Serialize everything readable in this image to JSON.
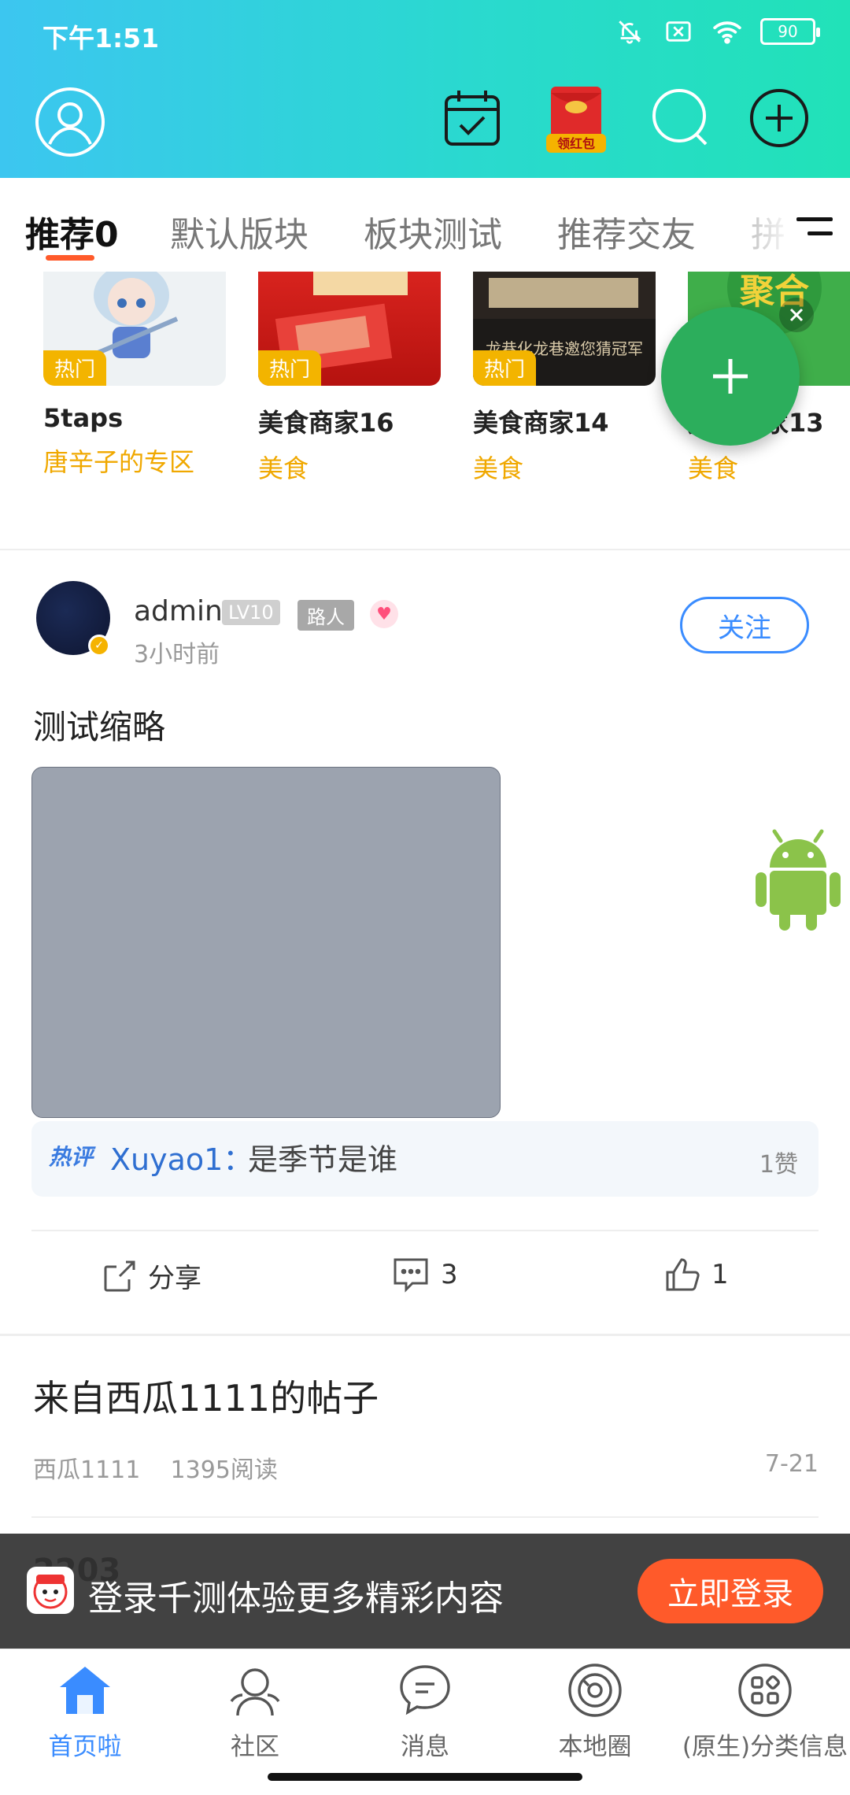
{
  "status_bar": {
    "time": "下午1:51",
    "battery": "90"
  },
  "header": {
    "icons": [
      "avatar-icon",
      "calendar-checkin-icon",
      "red-packet-icon",
      "search-icon",
      "plus-circle-icon"
    ],
    "red_packet_label": "领红包"
  },
  "tabs": [
    {
      "label": "推荐0",
      "active": true
    },
    {
      "label": "默认版块"
    },
    {
      "label": "板块测试"
    },
    {
      "label": "推荐交友"
    },
    {
      "label": "拼"
    }
  ],
  "boards": [
    {
      "name": "5taps",
      "category": "唐辛子的专区",
      "badge": "热门"
    },
    {
      "name": "美食商家16",
      "category": "美食",
      "badge": "热门"
    },
    {
      "name": "美食商家14",
      "category": "美食",
      "badge": "热门",
      "thumb_text": "龙巷化龙巷邀您猜冠军"
    },
    {
      "name": "美食商家13",
      "category": "美食",
      "thumb_text": "聚合"
    }
  ],
  "post1": {
    "username": "admin",
    "level": "LV10",
    "role": "路人",
    "time": "3小时前",
    "follow_label": "关注",
    "title": "测试缩略",
    "hot_comment": {
      "tag": "热评",
      "user": "Xuyao1",
      "text": "是季节是谁",
      "likes": "1赞"
    },
    "actions": {
      "share": "分享",
      "comments": "3",
      "likes": "1"
    }
  },
  "post2": {
    "title": "来自西瓜1111的帖子",
    "author": "西瓜1111",
    "reads": "1395阅读",
    "date": "7-21"
  },
  "post3_peek": "2203",
  "login_banner": {
    "message": "登录千测体验更多精彩内容",
    "button": "立即登录"
  },
  "bottom_nav": [
    {
      "label": "首页啦",
      "icon": "home-icon",
      "active": true
    },
    {
      "label": "社区",
      "icon": "community-icon"
    },
    {
      "label": "消息",
      "icon": "message-icon"
    },
    {
      "label": "本地圈",
      "icon": "local-circle-icon"
    },
    {
      "label": "(原生)分类信息",
      "icon": "category-icon"
    }
  ],
  "colors": {
    "accent": "#3a8cff",
    "orange": "#ff5a2a",
    "hot": "#f3b400",
    "fab": "#2cae5c"
  }
}
